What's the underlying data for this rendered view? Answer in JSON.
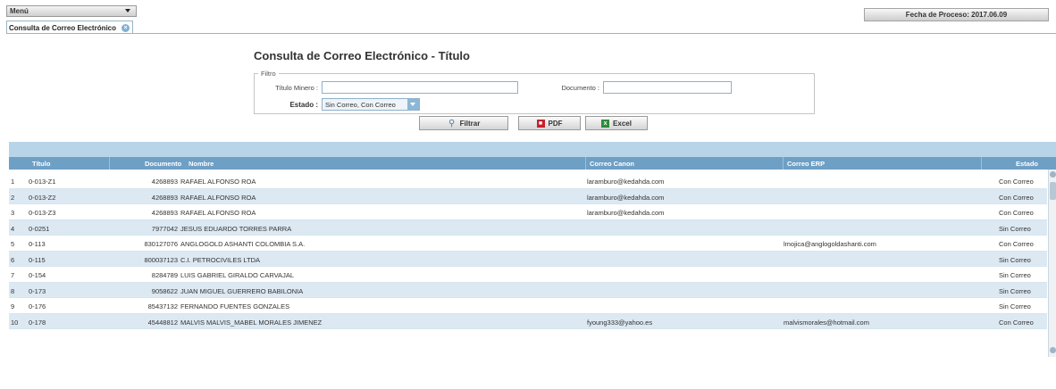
{
  "header": {
    "menu_label": "Menú",
    "process_date": "Fecha de Proceso: 2017.06.09"
  },
  "tab": {
    "label": "Consulta de Correo Electrónico"
  },
  "page": {
    "title": "Consulta de Correo Electrónico - Título"
  },
  "filter": {
    "legend": "Filtro",
    "titulo_label": "Título Minero :",
    "titulo_value": "",
    "documento_label": "Documento :",
    "documento_value": "",
    "estado_label": "Estado :",
    "estado_value": "Sin Correo, Con Correo"
  },
  "buttons": {
    "filter": "Filtrar",
    "pdf": "PDF",
    "excel": "Excel"
  },
  "grid": {
    "columns": [
      "Título",
      "Documento",
      "Nombre",
      "Correo Canon",
      "Correo ERP",
      "Estado"
    ],
    "rows": [
      {
        "n": "1",
        "titulo": "0-013-Z1",
        "documento": "4268893",
        "nombre": "RAFAEL ALFONSO ROA",
        "canon": "laramburo@kedahda.com",
        "erp": "",
        "estado": "Con Correo"
      },
      {
        "n": "2",
        "titulo": "0-013-Z2",
        "documento": "4268893",
        "nombre": "RAFAEL ALFONSO ROA",
        "canon": "laramburo@kedahda.com",
        "erp": "",
        "estado": "Con Correo"
      },
      {
        "n": "3",
        "titulo": "0-013-Z3",
        "documento": "4268893",
        "nombre": "RAFAEL ALFONSO ROA",
        "canon": "laramburo@kedahda.com",
        "erp": "",
        "estado": "Con Correo"
      },
      {
        "n": "4",
        "titulo": "0-0251",
        "documento": "7977042",
        "nombre": "JESUS EDUARDO TORRES PARRA",
        "canon": "",
        "erp": "",
        "estado": "Sin Correo"
      },
      {
        "n": "5",
        "titulo": "0-113",
        "documento": "830127076",
        "nombre": "ANGLOGOLD ASHANTI COLOMBIA S.A.",
        "canon": "",
        "erp": "lmojica@anglogoldashanti.com",
        "estado": "Con Correo"
      },
      {
        "n": "6",
        "titulo": "0-115",
        "documento": "800037123",
        "nombre": "C.I. PETROCIVILES LTDA",
        "canon": "",
        "erp": "",
        "estado": "Sin Correo"
      },
      {
        "n": "7",
        "titulo": "0-154",
        "documento": "8284789",
        "nombre": "LUIS GABRIEL GIRALDO CARVAJAL",
        "canon": "",
        "erp": "",
        "estado": "Sin Correo"
      },
      {
        "n": "8",
        "titulo": "0-173",
        "documento": "9058622",
        "nombre": "JUAN MIGUEL GUERRERO BABILONIA",
        "canon": "",
        "erp": "",
        "estado": "Sin Correo"
      },
      {
        "n": "9",
        "titulo": "0-176",
        "documento": "85437132",
        "nombre": "FERNANDO FUENTES GONZALES",
        "canon": "",
        "erp": "",
        "estado": "Sin Correo"
      },
      {
        "n": "10",
        "titulo": "0-178",
        "documento": "45448812",
        "nombre": "MALVIS MALVIS_MABEL MORALES JIMENEZ",
        "canon": "fyoung333@yahoo.es",
        "erp": "malvismorales@hotmail.com",
        "estado": "Con Correo"
      }
    ]
  }
}
